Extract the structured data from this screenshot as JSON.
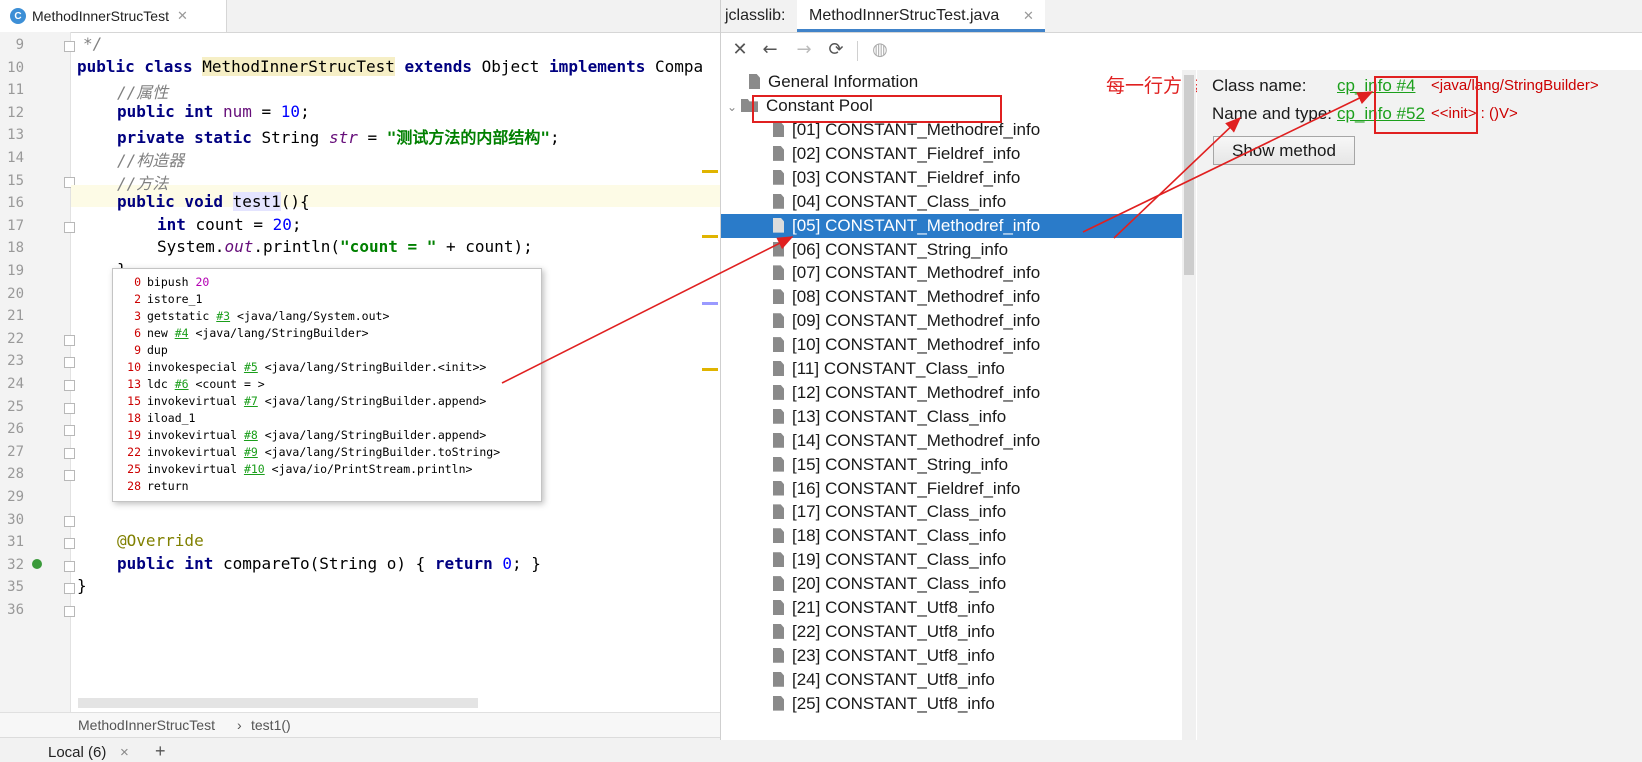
{
  "editor": {
    "tab_label": "MethodInnerStrucTest",
    "tab_icon": "C",
    "line_numbers": [
      "9",
      "10",
      "11",
      "12",
      "13",
      "14",
      "15",
      "16",
      "17",
      "18",
      "19",
      "20",
      "21",
      "22",
      "23",
      "24",
      "25",
      "26",
      "27",
      "28",
      "29",
      "30",
      "31",
      "32",
      "35",
      "36"
    ],
    "code": {
      "l9": "*/",
      "l10_public": "public class",
      "l10_class": "MethodInnerStrucTest",
      "l10_extends": "extends",
      "l10_object": "Object",
      "l10_implements": "implements",
      "l10_compa": "Compa",
      "l11": "//属性",
      "l12_kw": "public int",
      "l12_var": "num",
      "l12_eq": "=",
      "l12_num": "10",
      "l13_kw": "private static",
      "l13_type": "String",
      "l13_var": "str",
      "l13_eq": "=",
      "l13_str": "\"测试方法的内部结构\"",
      "l14": "//构造器",
      "l15": "//方法",
      "l16_kw": "public void",
      "l16_name": "test1",
      "l16_rest": "(){",
      "l17_kw": "int",
      "l17_rest": "count =",
      "l17_num": "20",
      "l18_a": "System.",
      "l18_out": "out",
      "l18_b": ".println(",
      "l18_str": "\"count = \"",
      "l18_c": "+ count);",
      "l19": "}",
      "l31": "@Override",
      "l32_kw": "public int",
      "l32_a": "compareTo(String o)",
      "l32_b": "{",
      "l32_ret": "return",
      "l32_num": "0",
      "l32_c": "}",
      "l35": "}"
    },
    "bytecode": [
      {
        "off": "0",
        "op": "bipush",
        "arg": "",
        "arg2": "20",
        "desc": ""
      },
      {
        "off": "2",
        "op": "istore_1",
        "arg": "",
        "arg2": "",
        "desc": ""
      },
      {
        "off": "3",
        "op": "getstatic",
        "arg": "#3",
        "arg2": "",
        "desc": "<java/lang/System.out>"
      },
      {
        "off": "6",
        "op": "new",
        "arg": "#4",
        "arg2": "",
        "desc": "<java/lang/StringBuilder>"
      },
      {
        "off": "9",
        "op": "dup",
        "arg": "",
        "arg2": "",
        "desc": ""
      },
      {
        "off": "10",
        "op": "invokespecial",
        "arg": "#5",
        "arg2": "",
        "desc": "<java/lang/StringBuilder.<init>>"
      },
      {
        "off": "13",
        "op": "ldc",
        "arg": "#6",
        "arg2": "",
        "desc": "<count = >"
      },
      {
        "off": "15",
        "op": "invokevirtual",
        "arg": "#7",
        "arg2": "",
        "desc": "<java/lang/StringBuilder.append>"
      },
      {
        "off": "18",
        "op": "iload_1",
        "arg": "",
        "arg2": "",
        "desc": ""
      },
      {
        "off": "19",
        "op": "invokevirtual",
        "arg": "#8",
        "arg2": "",
        "desc": "<java/lang/StringBuilder.append>"
      },
      {
        "off": "22",
        "op": "invokevirtual",
        "arg": "#9",
        "arg2": "",
        "desc": "<java/lang/StringBuilder.toString>"
      },
      {
        "off": "25",
        "op": "invokevirtual",
        "arg": "#10",
        "arg2": "",
        "desc": "<java/io/PrintStream.println>"
      },
      {
        "off": "28",
        "op": "return",
        "arg": "",
        "arg2": "",
        "desc": ""
      }
    ],
    "breadcrumb": {
      "class_name": "MethodInnerStrucTest",
      "sep": "›",
      "method": "test1()"
    }
  },
  "bottom_bar": {
    "tab_label": "Local (6)",
    "close": "×",
    "add": "+"
  },
  "jclasslib": {
    "tab_prefix": "jclasslib:",
    "tab_label": "MethodInnerStrucTest.java",
    "annotation_note": "每一行方法最好转成对常量池的引用",
    "tree": {
      "general": "General Information",
      "constant_pool": "Constant Pool",
      "items": [
        "[01] CONSTANT_Methodref_info",
        "[02] CONSTANT_Fieldref_info",
        "[03] CONSTANT_Fieldref_info",
        "[04] CONSTANT_Class_info",
        "[05] CONSTANT_Methodref_info",
        "[06] CONSTANT_String_info",
        "[07] CONSTANT_Methodref_info",
        "[08] CONSTANT_Methodref_info",
        "[09] CONSTANT_Methodref_info",
        "[10] CONSTANT_Methodref_info",
        "[11] CONSTANT_Class_info",
        "[12] CONSTANT_Methodref_info",
        "[13] CONSTANT_Class_info",
        "[14] CONSTANT_Methodref_info",
        "[15] CONSTANT_String_info",
        "[16] CONSTANT_Fieldref_info",
        "[17] CONSTANT_Class_info",
        "[18] CONSTANT_Class_info",
        "[19] CONSTANT_Class_info",
        "[20] CONSTANT_Class_info",
        "[21] CONSTANT_Utf8_info",
        "[22] CONSTANT_Utf8_info",
        "[23] CONSTANT_Utf8_info",
        "[24] CONSTANT_Utf8_info",
        "[25] CONSTANT_Utf8_info"
      ],
      "selected_index": 4
    },
    "detail": {
      "class_name_label": "Class name:",
      "class_name_link": "cp_info #4",
      "class_name_desc": "<java/lang/StringBuilder>",
      "name_type_label": "Name and type:",
      "name_type_link": "cp_info #52",
      "name_type_desc": "<<init> : ()V>",
      "show_method": "Show method"
    }
  },
  "colors": {
    "annotation_red": "#e02020",
    "selection_blue": "#2a7bc9",
    "link_green": "#1ca01c"
  },
  "icons": [
    "class-icon",
    "close-icon",
    "back-arrow-icon",
    "forward-arrow-icon",
    "refresh-icon",
    "web-icon",
    "file-icon",
    "folder-icon",
    "expand-chevron-icon"
  ]
}
